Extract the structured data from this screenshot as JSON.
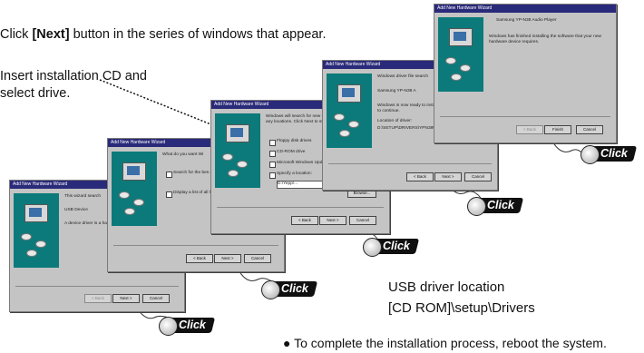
{
  "instructions": {
    "step1_prefix": "Click ",
    "step1_bold": "[Next]",
    "step1_suffix": " button in the series of windows that appear.",
    "cd_line1": "Insert installation CD and",
    "cd_line2": "select drive.",
    "usb_line1": "USB driver location",
    "usb_line2": "[CD ROM]\\setup\\Drivers",
    "reboot_bullet": "●",
    "reboot_text": "To complete the installation process, reboot the system."
  },
  "click_label": "Click",
  "wizard_title": "Add New Hardware Wizard",
  "windows": [
    {
      "text1": "This wizard search",
      "text2": "USB Device",
      "text3": "A device driver is a hardware device w",
      "back": "< Back",
      "next": "Next >",
      "cancel": "Cancel"
    },
    {
      "text1": "What do you want Wi",
      "opt1": "Search for the bes (Recommended)",
      "opt2": "Display a list of all location, so you c",
      "back": "< Back",
      "next": "Next >",
      "cancel": "Cancel"
    },
    {
      "text1": "Windows will search for new driver on your hard drive, and in any locations. Click Next to start",
      "opt1": "Floppy disk drives",
      "opt2": "CD-ROM drive",
      "opt3": "Microsoft Windows Upd",
      "opt4": "Specify a location:",
      "path": "D:\\Yepp\\...",
      "browse": "Browse...",
      "back": "< Back",
      "next": "Next >",
      "cancel": "Cancel"
    },
    {
      "text1": "Windows driver file search",
      "text2": "Samsung YP-N38 A",
      "text3": "Windows is now ready to install device. Click Back to select to continue.",
      "text4": "Location of driver:",
      "path": "D:\\SETUP\\DRIVERS\\YPN38U.INF",
      "back": "< Back",
      "next": "Next >",
      "cancel": "Cancel"
    },
    {
      "text1": "Samsung YP-N38 Audio Player",
      "text2": "Windows has finished installing the software that your new hardware device requires.",
      "back": "< Back",
      "finish": "Finish",
      "cancel": "Cancel"
    }
  ]
}
